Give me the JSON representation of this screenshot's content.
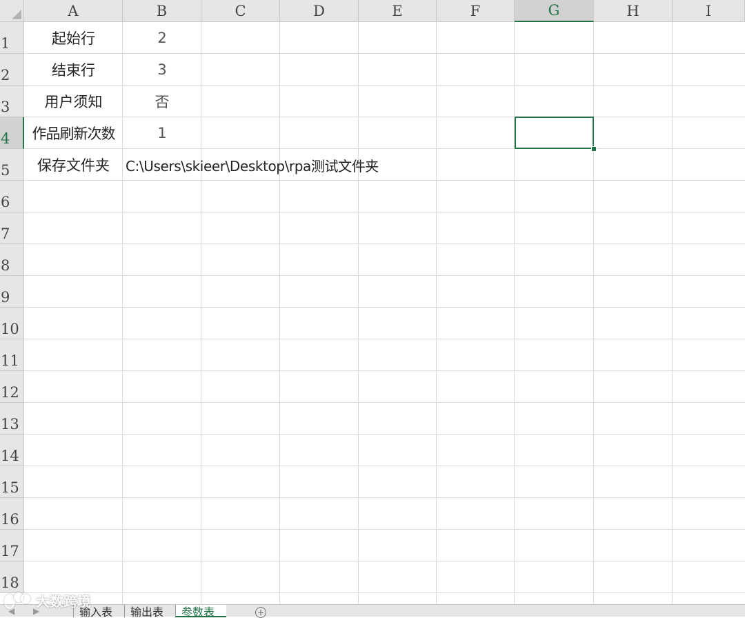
{
  "columns": [
    "A",
    "B",
    "C",
    "D",
    "E",
    "F",
    "G",
    "H",
    "I"
  ],
  "active_column": "G",
  "rows": [
    "1",
    "2",
    "3",
    "4",
    "5",
    "6",
    "7",
    "8",
    "9",
    "10",
    "11",
    "12",
    "13",
    "14",
    "15",
    "16",
    "17",
    "18"
  ],
  "active_row": "4",
  "cells": {
    "A1": "起始行",
    "B1": "2",
    "A2": "结束行",
    "B2": "3",
    "A3": "用户须知",
    "B3": "否",
    "A4": "作品刷新次数",
    "B4": "1",
    "A5": "保存文件夹",
    "B5": "C:\\Users\\skieer\\Desktop\\rpa测试文件夹"
  },
  "selected_cell": "G4",
  "sheet_tabs": [
    {
      "label": "输入表",
      "active": false
    },
    {
      "label": "输出表",
      "active": false
    },
    {
      "label": "参数表",
      "active": true
    }
  ],
  "add_sheet_symbol": "+",
  "nav_arrows": {
    "prev": "◀",
    "next": "▶"
  },
  "watermark": {
    "text": "大数跨境",
    "logo": "logo-icon"
  },
  "colors": {
    "accent": "#217346",
    "header_bg": "#e6e6e6",
    "gridline": "#dadada"
  }
}
